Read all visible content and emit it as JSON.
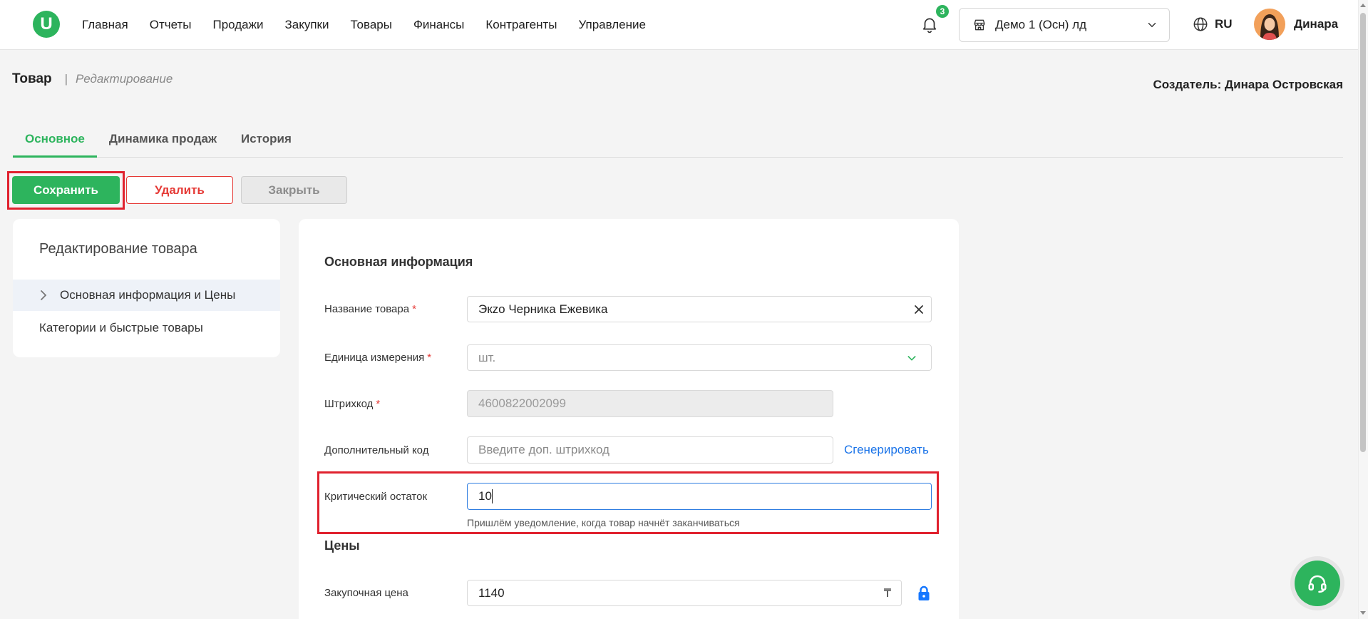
{
  "header": {
    "logo_letter": "U",
    "nav": [
      "Главная",
      "Отчеты",
      "Продажи",
      "Закупки",
      "Товары",
      "Финансы",
      "Контрагенты",
      "Управление"
    ],
    "notifications_count": "3",
    "store_name": "Демо 1 (Осн) лд",
    "language": "RU",
    "user_name": "Динара"
  },
  "page": {
    "title": "Товар",
    "separator": "|",
    "mode": "Редактирование",
    "creator": "Создатель: Динара Островская"
  },
  "tabs": [
    {
      "label": "Основное",
      "active": true
    },
    {
      "label": "Динамика продаж",
      "active": false
    },
    {
      "label": "История",
      "active": false
    }
  ],
  "actions": {
    "save": "Сохранить",
    "delete": "Удалить",
    "close": "Закрыть"
  },
  "sidebar": {
    "title": "Редактирование товара",
    "items": [
      {
        "label": "Основная информация и Цены",
        "active": true
      },
      {
        "label": "Категории и быстрые товары",
        "active": false
      }
    ]
  },
  "form": {
    "main_section_title": "Основная информация",
    "name": {
      "label": "Название товара",
      "required_mark": "*",
      "value": "Экzo Черника Ежевика"
    },
    "unit": {
      "label": "Единица измерения",
      "required_mark": "*",
      "value": "шт."
    },
    "barcode": {
      "label": "Штрихкод",
      "required_mark": "*",
      "value": "4600822002099",
      "disabled": true
    },
    "extra_code": {
      "label": "Дополнительный код",
      "placeholder": "Введите доп. штрихкод",
      "generate_link": "Сгенерировать"
    },
    "critical_stock": {
      "label": "Критический остаток",
      "value": "10",
      "hint": "Пришлём уведомление, когда товар начнёт заканчиваться",
      "focused": true
    },
    "prices_section_title": "Цены",
    "purchase_price": {
      "label": "Закупочная цена",
      "value": "1140",
      "currency_symbol": "₸",
      "locked": true
    }
  },
  "icons": {
    "notifications": "bell-icon",
    "store": "store-icon",
    "dropdown": "chevron-down-icon",
    "language": "globe-icon",
    "sidebar_active": "chevron-right-icon",
    "clear": "close-icon",
    "price_lock": "lock-icon",
    "support": "headset-icon"
  },
  "colors": {
    "brand_green": "#2db45d",
    "danger_red": "#e53935",
    "link_blue": "#1a73e8",
    "highlight_red": "#e0212e",
    "focus_blue": "#2f7de1",
    "lock_blue": "#1677ff"
  }
}
